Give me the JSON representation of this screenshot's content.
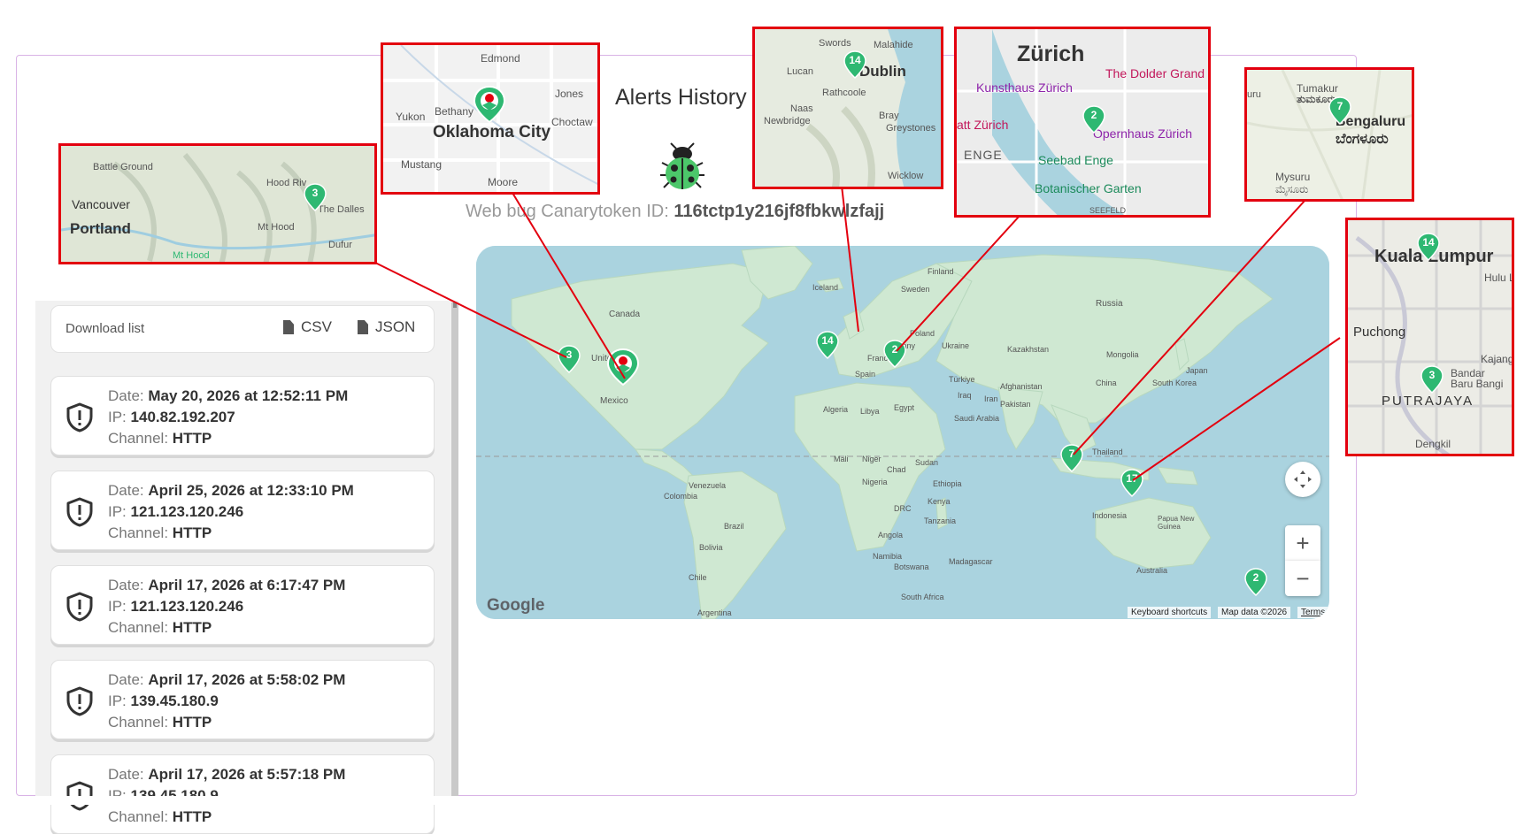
{
  "header": {
    "title": "Alerts History",
    "token_label": "Web bug Canarytoken ID:",
    "token_id": "116tctp1y216jf8fbkwlzfajj"
  },
  "download": {
    "label": "Download list",
    "csv": "CSV",
    "json": "JSON"
  },
  "alert_labels": {
    "date": "Date:",
    "ip": "IP:",
    "channel": "Channel:"
  },
  "alerts": [
    {
      "date": "May 20, 2026 at 12:52:11 PM",
      "ip": "140.82.192.207",
      "channel": "HTTP"
    },
    {
      "date": "April 25, 2026 at 12:33:10 PM",
      "ip": "121.123.120.246",
      "channel": "HTTP"
    },
    {
      "date": "April 17, 2026 at 6:17:47 PM",
      "ip": "121.123.120.246",
      "channel": "HTTP"
    },
    {
      "date": "April 17, 2026 at 5:58:02 PM",
      "ip": "139.45.180.9",
      "channel": "HTTP"
    },
    {
      "date": "April 17, 2026 at 5:57:18 PM",
      "ip": "139.45.180.9",
      "channel": "HTTP"
    }
  ],
  "map": {
    "attribution_logo": "Google",
    "keyboard_shortcuts": "Keyboard shortcuts",
    "map_data": "Map data ©2026",
    "terms": "Terms",
    "zoom_in": "+",
    "zoom_out": "−",
    "clusters": [
      {
        "count": "3"
      },
      {
        "count": "14"
      },
      {
        "count": "2"
      },
      {
        "count": "7"
      },
      {
        "count": "17"
      },
      {
        "count": "2"
      }
    ],
    "labels": {
      "canada": "Canada",
      "united_states": "United",
      "mexico": "Mexico",
      "iceland": "Iceland",
      "finland": "Finland",
      "sweden": "Sweden",
      "russia": "Russia",
      "poland": "Poland",
      "ukraine": "Ukraine",
      "france": "France",
      "germany": "many",
      "spain": "Spain",
      "kazakhstan": "Kazakhstan",
      "mongolia": "Mongolia",
      "turkiye": "Türkiye",
      "algeria": "Algeria",
      "libya": "Libya",
      "egypt": "Egypt",
      "iraq": "Iraq",
      "iran": "Iran",
      "afghanistan": "Afghanistan",
      "pakistan": "Pakistan",
      "china": "China",
      "south_korea": "South Korea",
      "japan": "Japan",
      "saudi": "Saudi Arabia",
      "thailand": "Thailand",
      "mali": "Mali",
      "niger": "Niger",
      "chad": "Chad",
      "sudan": "Sudan",
      "nigeria": "Nigeria",
      "ethiopia": "Ethiopia",
      "kenya": "Kenya",
      "drc": "DRC",
      "tanzania": "Tanzania",
      "angola": "Angola",
      "namibia": "Namibia",
      "botswana": "Botswana",
      "madagascar": "Madagascar",
      "south_africa": "South Africa",
      "venezuela": "Venezuela",
      "colombia": "Colombia",
      "brazil": "Brazil",
      "bolivia": "Bolivia",
      "chile": "Chile",
      "argentina": "Argentina",
      "indonesia": "Indonesia",
      "papua": "Papua New Guinea",
      "australia": "Australia"
    }
  },
  "insets": {
    "portland": {
      "labels": [
        "Battle Ground",
        "Vancouver",
        "Portland",
        "Hood Riv",
        "The Dalles",
        "Mt Hood",
        "Dufur",
        "Mt Hood"
      ],
      "pin": "3"
    },
    "oklahoma": {
      "labels": [
        "Edmond",
        "Bethany",
        "Yukon",
        "Oklahoma City",
        "Jones",
        "Choctaw",
        "Mustang",
        "Moore"
      ]
    },
    "dublin": {
      "labels": [
        "Swords",
        "Malahide",
        "Lucan",
        "Dublin",
        "Rathcoole",
        "Naas",
        "Newbridge",
        "Bray",
        "Greystones",
        "Wicklow"
      ],
      "pin": "14"
    },
    "zurich": {
      "labels": [
        "Zürich",
        "The Dolder Grand",
        "Kunsthaus Zürich",
        "att Zürich",
        "Opernhaus Zürich",
        "ENGE",
        "Seebad Enge",
        "Botanischer Garten",
        "SEEFELD"
      ],
      "pin": "2"
    },
    "bengaluru": {
      "labels": [
        "Tumakur",
        "ತುಮಕೂರು",
        "Bengaluru",
        "ಬೆಂಗಳೂರು",
        "Mysuru",
        "ಮೈಸೂರು",
        "uru"
      ],
      "pin": "7"
    },
    "kuala_lumpur": {
      "labels": [
        "Kuala Lumpur",
        "Hulu La",
        "Puchong",
        "Kajang",
        "Bandar",
        "Baru Bangi",
        "PUTRAJAYA",
        "Dengkil"
      ],
      "pins": [
        "14",
        "3"
      ]
    }
  }
}
